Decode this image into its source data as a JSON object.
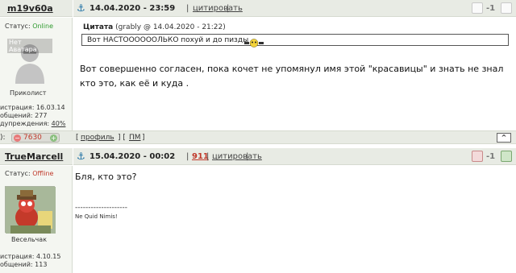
{
  "post1": {
    "author": "m19v60a",
    "date": "14.04.2020 - 23:59",
    "cite_label": "цитировать",
    "rep_value": "-1",
    "status_label": "Статус:",
    "status_value": "Online",
    "avatar_text": "Нет Аватара",
    "rank": "Приколист",
    "reg_label": "истрация:",
    "reg_date": "16.03.14",
    "posts_label": "общений:",
    "posts_count": "277",
    "warn_label": "дупреждения:",
    "warn_value": "40%",
    "quote_title": "Цитата",
    "quote_meta": "(grably @ 14.04.2020 - 21:22)",
    "quote_text": "Вот НАСТООООООЛЬКО похуй и до пизды",
    "message": "Вот совершенно согласен, пока кочет не упомянул имя этой \"красавицы\" и знать не знал кто это, как её и куда ."
  },
  "footer": {
    "label": "):",
    "karma": "7630",
    "profile": "профиль",
    "pm": "ПМ",
    "up": "^"
  },
  "post2": {
    "author": "TrueMarcell",
    "date": "15.04.2020 - 00:02",
    "count": "911",
    "cite_label": "цитировать",
    "rep_value": "-1",
    "status_label": "Статус:",
    "status_value": "Offline",
    "rank": "Весельчак",
    "reg_label": "истрация:",
    "reg_date": "4.10.15",
    "posts_label": "общений:",
    "posts_count": "113",
    "message": "Бля, кто это?",
    "sig_line": "--------------------",
    "signature": "Ne Quid Nimis!"
  },
  "colors": {
    "online": "#2e9a2e",
    "offline": "#c0392b",
    "accent": "#f0892e",
    "header_bg": "#e8ebe4"
  }
}
